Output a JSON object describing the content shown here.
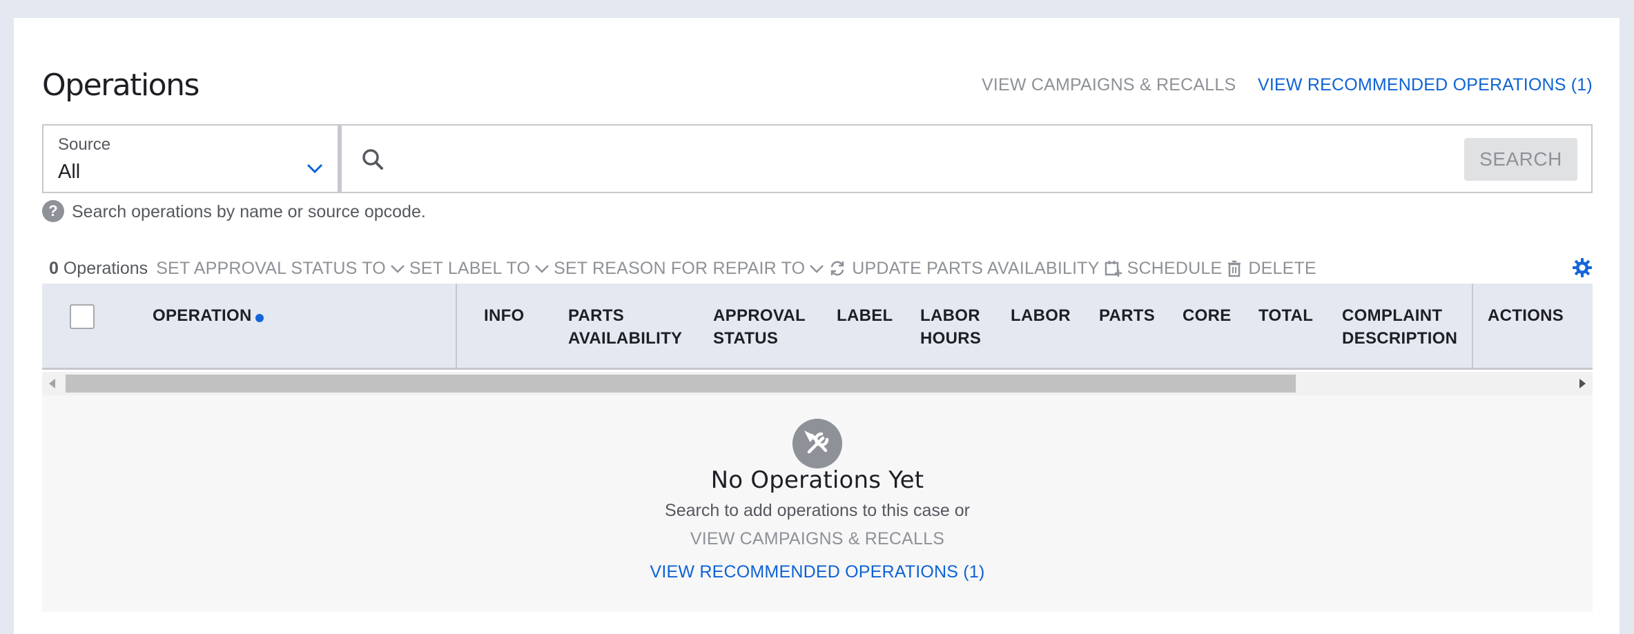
{
  "header": {
    "title": "Operations",
    "view_campaigns_label": "VIEW CAMPAIGNS & RECALLS",
    "view_recommended_label": "VIEW RECOMMENDED OPERATIONS (1)"
  },
  "search": {
    "source_label": "Source",
    "source_value": "All",
    "value": "",
    "placeholder": "",
    "button_label": "SEARCH",
    "help_text": "Search operations by name or source opcode."
  },
  "toolbar": {
    "count_number": "0",
    "count_label": "Operations",
    "set_approval_label": "SET APPROVAL STATUS TO",
    "set_label_label": "SET LABEL TO",
    "set_reason_label": "SET REASON FOR REPAIR TO",
    "update_parts_label": "UPDATE PARTS AVAILABILITY",
    "schedule_label": "SCHEDULE",
    "delete_label": "DELETE"
  },
  "table": {
    "columns": {
      "operation": "OPERATION",
      "info": "INFO",
      "parts_availability_1": "PARTS",
      "parts_availability_2": "AVAILABILITY",
      "approval_status_1": "APPROVAL",
      "approval_status_2": "STATUS",
      "label": "LABEL",
      "labor_hours_1": "LABOR",
      "labor_hours_2": "HOURS",
      "labor": "LABOR",
      "parts": "PARTS",
      "core": "CORE",
      "total": "TOTAL",
      "complaint_description_1": "COMPLAINT",
      "complaint_description_2": "DESCRIPTION",
      "actions": "ACTIONS"
    }
  },
  "empty_state": {
    "icon": "tools-icon",
    "title": "No Operations Yet",
    "subtitle": "Search to add operations to this case or",
    "view_campaigns_label": "VIEW CAMPAIGNS & RECALLS",
    "view_recommended_label": "VIEW RECOMMENDED OPERATIONS (1)"
  },
  "colors": {
    "accent": "#0d63d4",
    "muted": "#8e9197",
    "page_bg": "#e4e8f0",
    "header_row_bg": "#e4e8f0"
  }
}
